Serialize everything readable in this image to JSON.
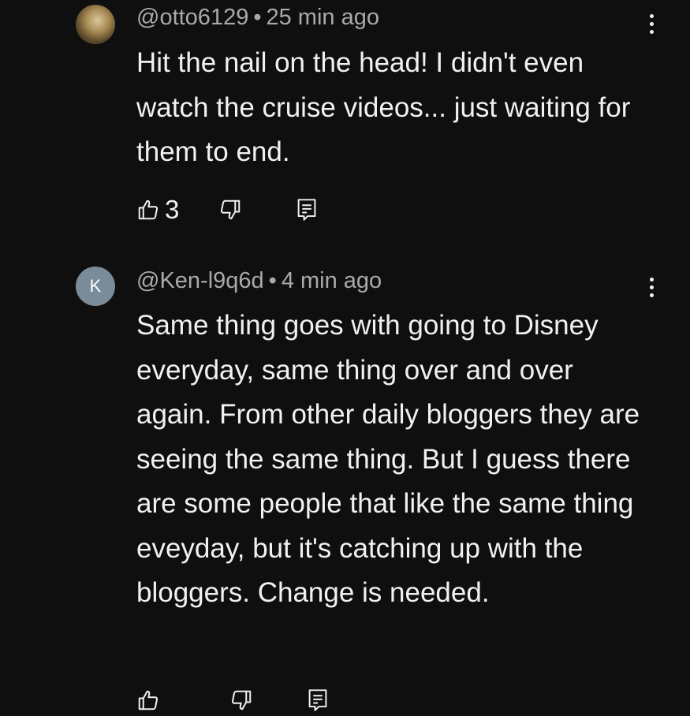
{
  "comments": [
    {
      "author": "@otto6129",
      "separator": "•",
      "time": "25 min ago",
      "avatar_letter": "",
      "text": "Hit the nail on the head!  I didn't even watch the cruise videos... just waiting for them to end.",
      "like_count": "3"
    },
    {
      "author": "@Ken-l9q6d",
      "separator": "•",
      "time": "4 min ago",
      "avatar_letter": "K",
      "text": "Same thing goes with going to Disney everyday, same thing over and over again. From other daily bloggers they are seeing the same thing. But I guess there are some people that like the same thing eveyday, but it's catching up with the bloggers. Change is needed.",
      "like_count": ""
    }
  ],
  "icons": {
    "like": "thumbs-up-icon",
    "dislike": "thumbs-down-icon",
    "reply": "reply-icon",
    "more": "more-vertical-icon"
  },
  "colors": {
    "background": "#0f0f0f",
    "primary_text": "#f1f1f1",
    "secondary_text": "#aaaaaa",
    "avatar_k": "#7a8b99"
  }
}
